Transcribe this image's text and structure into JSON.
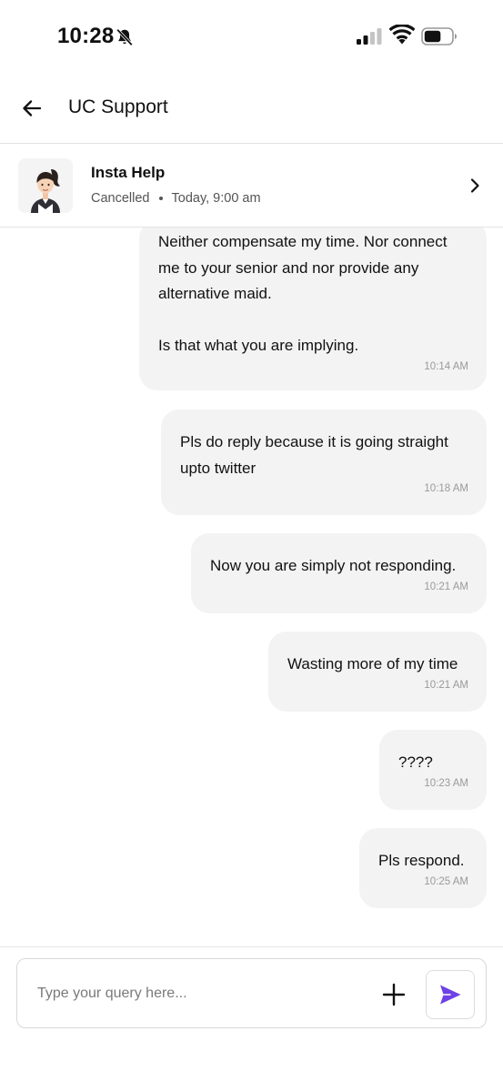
{
  "status_bar": {
    "time": "10:28",
    "icons": [
      "bell-off-icon",
      "cellular-signal-icon",
      "wifi-icon",
      "battery-icon"
    ]
  },
  "header": {
    "back_icon": "arrow-left-icon",
    "title": "UC Support"
  },
  "service": {
    "name": "Insta Help",
    "status": "Cancelled",
    "datetime": "Today, 9:00 am",
    "avatar_icon": "maid-avatar-icon",
    "chevron_icon": "chevron-right-icon"
  },
  "messages": [
    {
      "text": "Neither compensate my time. Nor connect me to your senior and nor provide any alternative maid.\n\nIs that what you are implying.",
      "time": "10:14 AM"
    },
    {
      "text": "Pls do reply because it is going straight upto twitter",
      "time": "10:18 AM"
    },
    {
      "text": "Now you are simply not responding.",
      "time": "10:21 AM"
    },
    {
      "text": "Wasting more of my time",
      "time": "10:21 AM"
    },
    {
      "text": "????",
      "time": "10:23 AM"
    },
    {
      "text": "Pls respond.",
      "time": "10:25 AM"
    }
  ],
  "composer": {
    "placeholder": "Type your query here...",
    "value": "",
    "add_icon": "plus-icon",
    "send_icon": "send-icon"
  },
  "colors": {
    "bubble_background": "#f3f3f3",
    "send_accent": "#6e42e5",
    "divider": "#e2e2e2"
  }
}
